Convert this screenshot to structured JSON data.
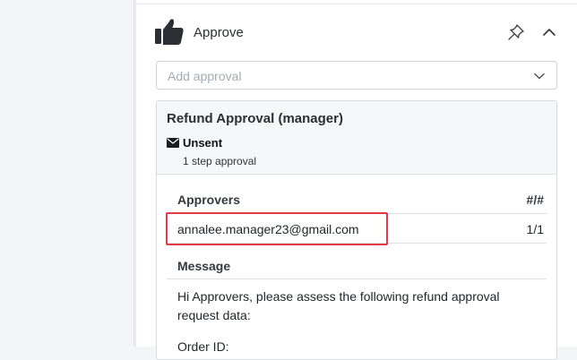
{
  "panel": {
    "title": "Approve",
    "icons": {
      "header": "thumbs-up-icon",
      "pin": "pin-icon",
      "collapse": "chevron-up-icon",
      "dropdown": "chevron-down-icon",
      "status": "envelope-icon"
    }
  },
  "add_approval": {
    "placeholder": "Add approval"
  },
  "approval_card": {
    "title": "Refund Approval (manager)",
    "status": "Unsent",
    "steps": "1 step approval",
    "approvers_header": "Approvers",
    "count_header": "#/#",
    "approvers": [
      {
        "email": "annalee.manager23@gmail.com",
        "count": "1/1"
      }
    ],
    "message_header": "Message",
    "message_body": "Hi Approvers, please assess the following refund approval request data:",
    "message_next": "Order ID:"
  },
  "colors": {
    "highlight": "#e23a47",
    "icon": "#2b2f33"
  }
}
